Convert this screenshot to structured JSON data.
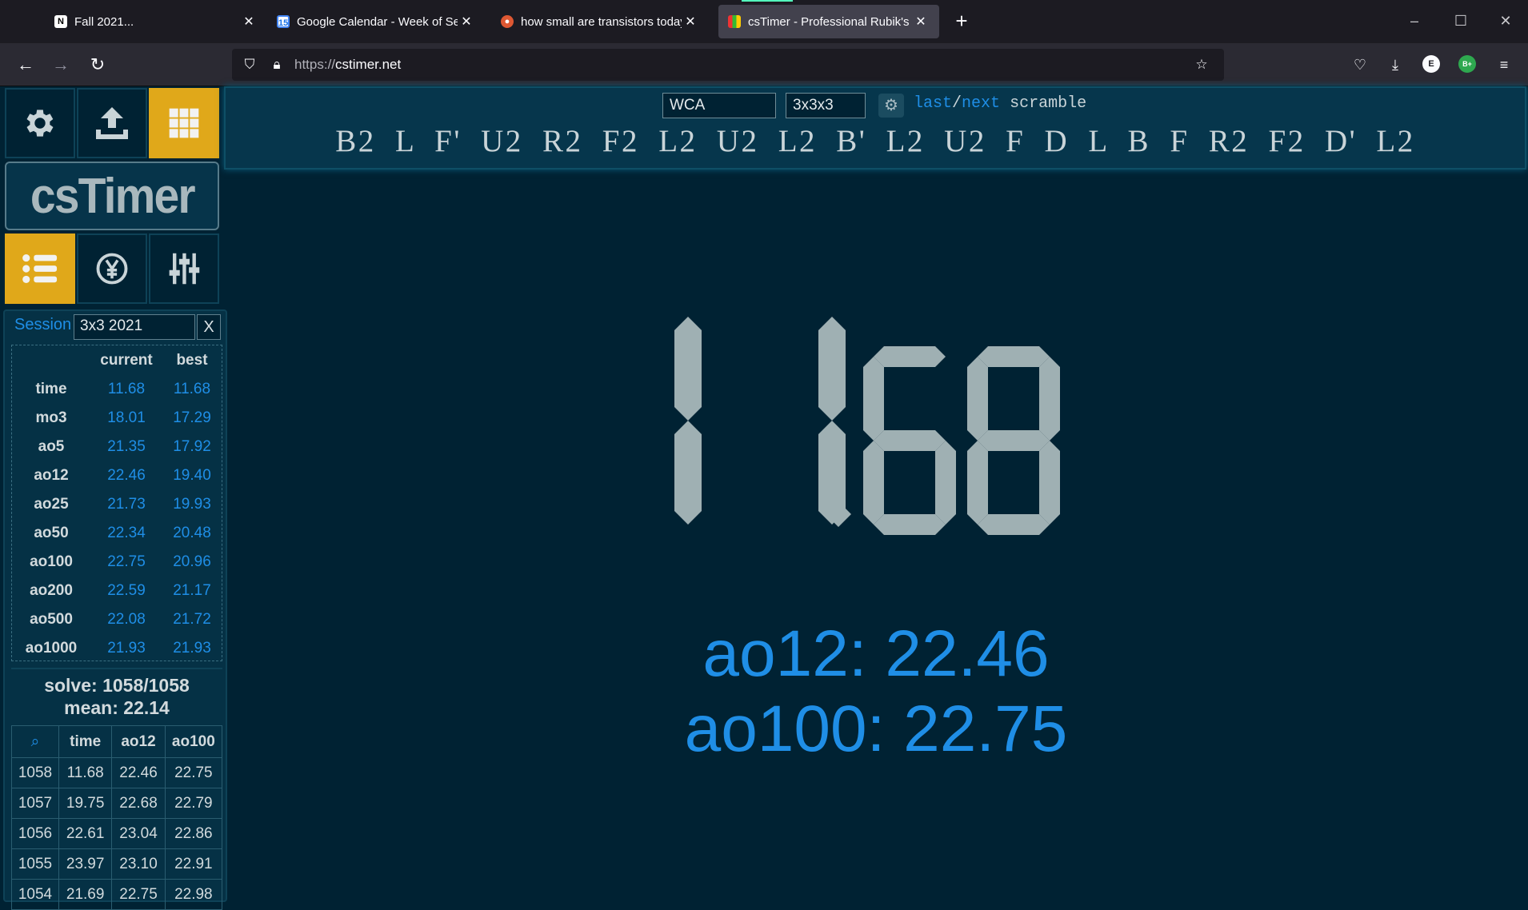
{
  "browser": {
    "tabs": [
      {
        "title": "Fall 2021...",
        "icon": "notion-icon"
      },
      {
        "title": "Google Calendar - Week of Sep",
        "icon": "calendar-icon"
      },
      {
        "title": "how small are transistors today",
        "icon": "duckduckgo-icon"
      },
      {
        "title": "csTimer - Professional Rubik's C",
        "icon": "cstimer-icon",
        "active": true
      }
    ],
    "url_prefix": "https://",
    "url_domain": "cstimer.net"
  },
  "logo": "csTimer",
  "session": {
    "label": "Session",
    "name": "3x3 2021",
    "close": "X"
  },
  "stats": {
    "header": {
      "current": "current",
      "best": "best"
    },
    "rows": [
      {
        "name": "time",
        "current": "11.68",
        "best": "11.68"
      },
      {
        "name": "mo3",
        "current": "18.01",
        "best": "17.29"
      },
      {
        "name": "ao5",
        "current": "21.35",
        "best": "17.92"
      },
      {
        "name": "ao12",
        "current": "22.46",
        "best": "19.40"
      },
      {
        "name": "ao25",
        "current": "21.73",
        "best": "19.93"
      },
      {
        "name": "ao50",
        "current": "22.34",
        "best": "20.48"
      },
      {
        "name": "ao100",
        "current": "22.75",
        "best": "20.96"
      },
      {
        "name": "ao200",
        "current": "22.59",
        "best": "21.17"
      },
      {
        "name": "ao500",
        "current": "22.08",
        "best": "21.72"
      },
      {
        "name": "ao1000",
        "current": "21.93",
        "best": "21.93"
      }
    ]
  },
  "summary": {
    "solve": "solve: 1058/1058",
    "mean": "mean: 22.14"
  },
  "times": {
    "headers": [
      "⌕",
      "time",
      "ao12",
      "ao100"
    ],
    "rows": [
      [
        "1058",
        "11.68",
        "22.46",
        "22.75"
      ],
      [
        "1057",
        "19.75",
        "22.68",
        "22.79"
      ],
      [
        "1056",
        "22.61",
        "23.04",
        "22.86"
      ],
      [
        "1055",
        "23.97",
        "23.10",
        "22.91"
      ],
      [
        "1054",
        "21.69",
        "22.75",
        "22.98"
      ]
    ]
  },
  "scramble": {
    "event": "WCA",
    "puzzle": "3x3x3",
    "last": "last",
    "slash": "/",
    "next": "next",
    "word": "scramble",
    "moves": "B2 L F' U2 R2 F2 L2 U2 L2 B' L2 U2 F D L B F R2 F2 D' L2"
  },
  "timer": {
    "value": "11.68",
    "color": "#9fb0b3"
  },
  "averages": {
    "ao12": "ao12: 22.46",
    "ao100": "ao100: 22.75"
  },
  "colors": {
    "accent": "#1f8ee6",
    "gold": "#e0a81a",
    "background": "#002233"
  }
}
